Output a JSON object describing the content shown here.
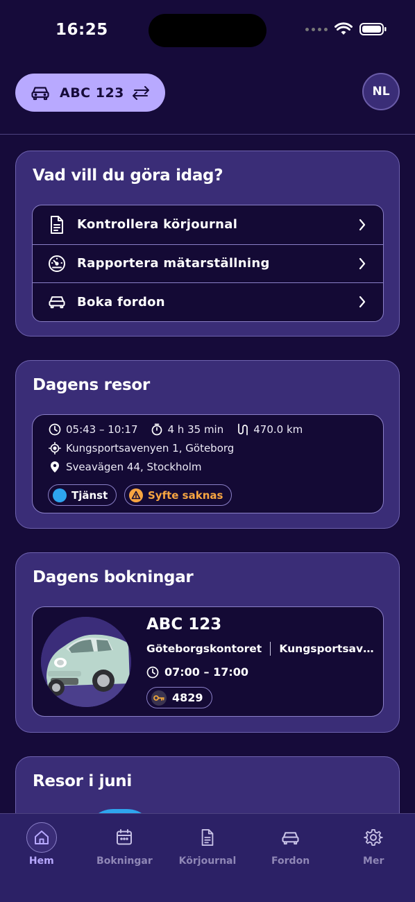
{
  "status_bar": {
    "time": "16:25"
  },
  "header": {
    "vehicle_plate": "ABC 123",
    "user_initials": "NL"
  },
  "quick_actions": {
    "title": "Vad vill du göra idag?",
    "items": [
      {
        "label": "Kontrollera körjournal",
        "icon": "document-icon"
      },
      {
        "label": "Rapportera mätarställning",
        "icon": "gauge-icon"
      },
      {
        "label": "Boka fordon",
        "icon": "car-icon"
      }
    ]
  },
  "todays_trips": {
    "title": "Dagens resor",
    "trip": {
      "time_range": "05:43 – 10:17",
      "duration": "4 h 35 min",
      "distance": "470.0 km",
      "from": "Kungsportsavenyen 1, Göteborg",
      "to": "Sveavägen 44, Stockholm",
      "tags": [
        {
          "label": "Tjänst",
          "color": "#2ea5ee"
        },
        {
          "label": "Syfte saknas",
          "color": "#f7a541"
        }
      ]
    }
  },
  "todays_bookings": {
    "title": "Dagens bokningar",
    "booking": {
      "plate": "ABC 123",
      "location": "Göteborgskontoret",
      "location_secondary": "Kungsportsavenyen",
      "time_range": "07:00 – 17:00",
      "key_code": "4829"
    }
  },
  "monthly_trips": {
    "title": "Resor i juni"
  },
  "tabbar": {
    "active": "Hem",
    "tabs": [
      {
        "label": "Hem",
        "icon": "home-icon"
      },
      {
        "label": "Bokningar",
        "icon": "calendar-icon"
      },
      {
        "label": "Körjournal",
        "icon": "document-icon"
      },
      {
        "label": "Fordon",
        "icon": "car-icon"
      },
      {
        "label": "Mer",
        "icon": "gear-icon"
      }
    ]
  },
  "colors": {
    "background": "#160b3a",
    "card": "#3a2d77",
    "accent": "#b8a9ff",
    "service_tag": "#2ea5ee",
    "warning": "#f7a541"
  }
}
